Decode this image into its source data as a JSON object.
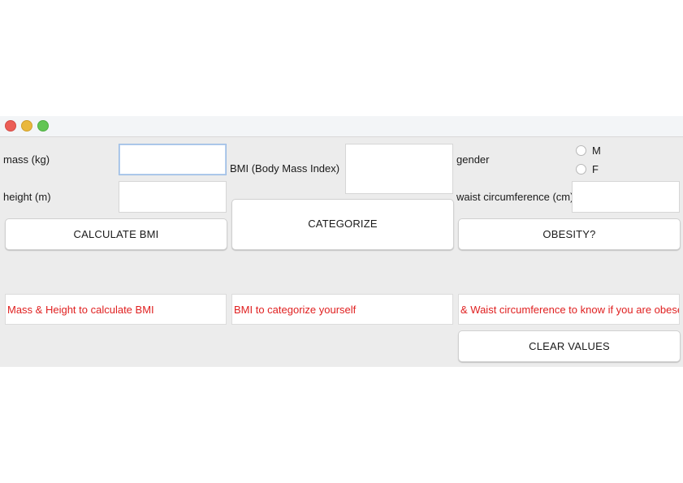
{
  "labels": {
    "mass": "mass (kg)",
    "height": "height (m)",
    "bmi": "BMI (Body Mass Index)",
    "gender": "gender",
    "waist": "waist circumference (cm)"
  },
  "gender_options": {
    "male": "M",
    "female": "F"
  },
  "buttons": {
    "calculate": "CALCULATE BMI",
    "categorize": "CATEGORIZE",
    "obesity": "OBESITY?",
    "clear": "CLEAR VALUES"
  },
  "messages": {
    "bmi": "Mass & Height to calculate BMI",
    "category": "BMI to categorize yourself",
    "obesity": "& Waist circumference to know if you are obese"
  },
  "colors": {
    "message_text": "#e02020",
    "window_bg": "#ececec"
  }
}
